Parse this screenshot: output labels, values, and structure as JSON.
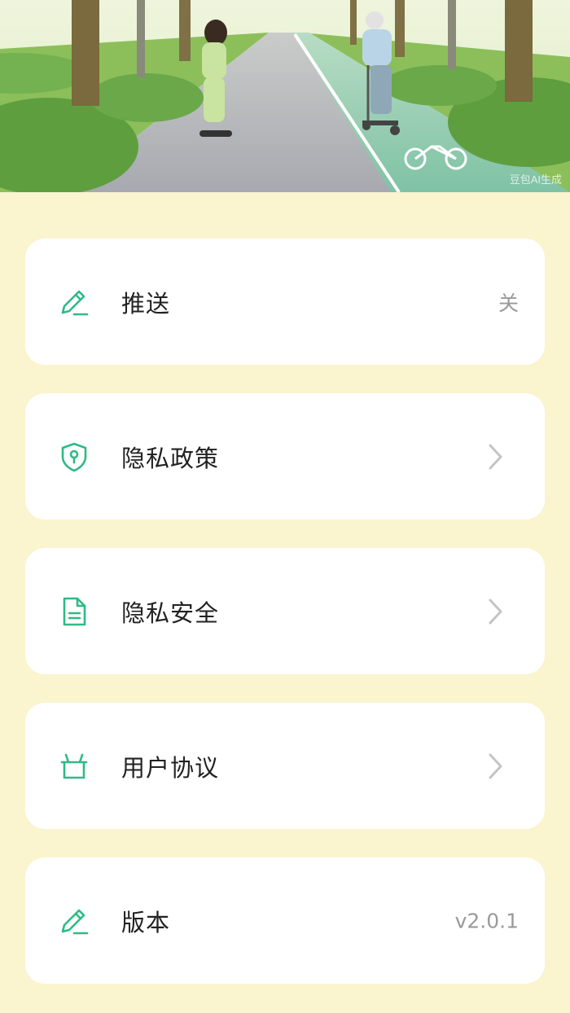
{
  "banner": {
    "watermark": "豆包AI生成",
    "image_description_icon": "park-path-illustration"
  },
  "settings": {
    "accent_color": "#2dbb85",
    "items": [
      {
        "id": "push",
        "icon": "pencil-icon",
        "label": "推送",
        "value": "关",
        "trailing": "value"
      },
      {
        "id": "privacy-policy",
        "icon": "shield-lock-icon",
        "label": "隐私政策",
        "value": "",
        "trailing": "chevron"
      },
      {
        "id": "privacy-security",
        "icon": "document-icon",
        "label": "隐私安全",
        "value": "",
        "trailing": "chevron"
      },
      {
        "id": "user-agreement",
        "icon": "basket-icon",
        "label": "用户协议",
        "value": "",
        "trailing": "chevron"
      },
      {
        "id": "version",
        "icon": "pencil-icon",
        "label": "版本",
        "value": "v2.0.1",
        "trailing": "value"
      }
    ]
  }
}
